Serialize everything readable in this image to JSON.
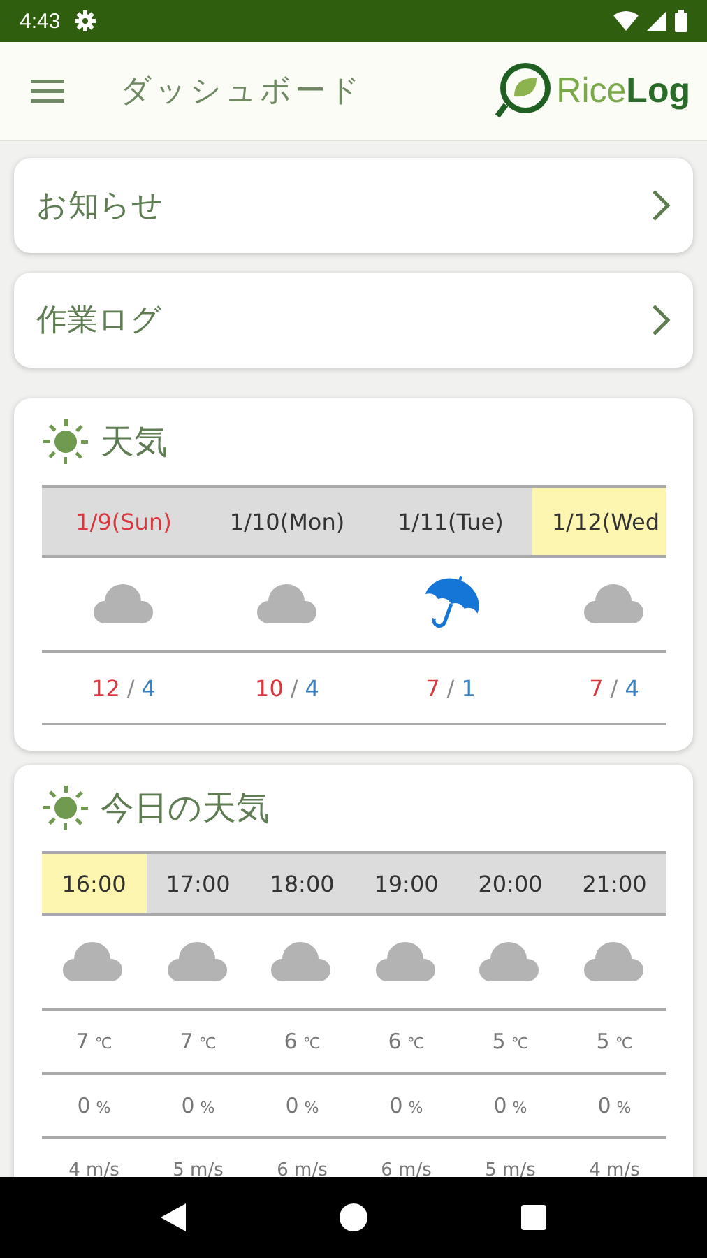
{
  "status_bar": {
    "time": "4:43"
  },
  "app_bar": {
    "title": "ダッシュボード",
    "logo_text_light": "Rice",
    "logo_text_bold": "Log"
  },
  "menu_cards": [
    {
      "label": "お知らせ"
    },
    {
      "label": "作業ログ"
    }
  ],
  "weather": {
    "title": "天気",
    "days": [
      {
        "date": "1/9(Sun)",
        "holiday": true,
        "selected": false,
        "kind": "cloud",
        "high": "12",
        "separator": "/",
        "low": "4"
      },
      {
        "date": "1/10(Mon)",
        "holiday": false,
        "selected": false,
        "kind": "cloud",
        "high": "10",
        "separator": "/",
        "low": "4"
      },
      {
        "date": "1/11(Tue)",
        "holiday": false,
        "selected": false,
        "kind": "umbrella",
        "high": "7",
        "separator": "/",
        "low": "1"
      },
      {
        "date": "1/12(Wed",
        "holiday": false,
        "selected": true,
        "kind": "cloud",
        "high": "7",
        "separator": "/",
        "low": "4"
      }
    ]
  },
  "today": {
    "title": "今日の天気",
    "hours": [
      {
        "time": "16:00",
        "selected": true,
        "kind": "cloud",
        "temp": "7",
        "rain": "0",
        "wind": "4 m/s"
      },
      {
        "time": "17:00",
        "selected": false,
        "kind": "cloud",
        "temp": "7",
        "rain": "0",
        "wind": "5 m/s"
      },
      {
        "time": "18:00",
        "selected": false,
        "kind": "cloud",
        "temp": "6",
        "rain": "0",
        "wind": "6 m/s"
      },
      {
        "time": "19:00",
        "selected": false,
        "kind": "cloud",
        "temp": "6",
        "rain": "0",
        "wind": "6 m/s"
      },
      {
        "time": "20:00",
        "selected": false,
        "kind": "cloud",
        "temp": "5",
        "rain": "0",
        "wind": "5 m/s"
      },
      {
        "time": "21:00",
        "selected": false,
        "kind": "cloud",
        "temp": "5",
        "rain": "0",
        "wind": "4 m/s"
      }
    ],
    "temp_unit": "℃",
    "rain_unit": "%"
  }
}
